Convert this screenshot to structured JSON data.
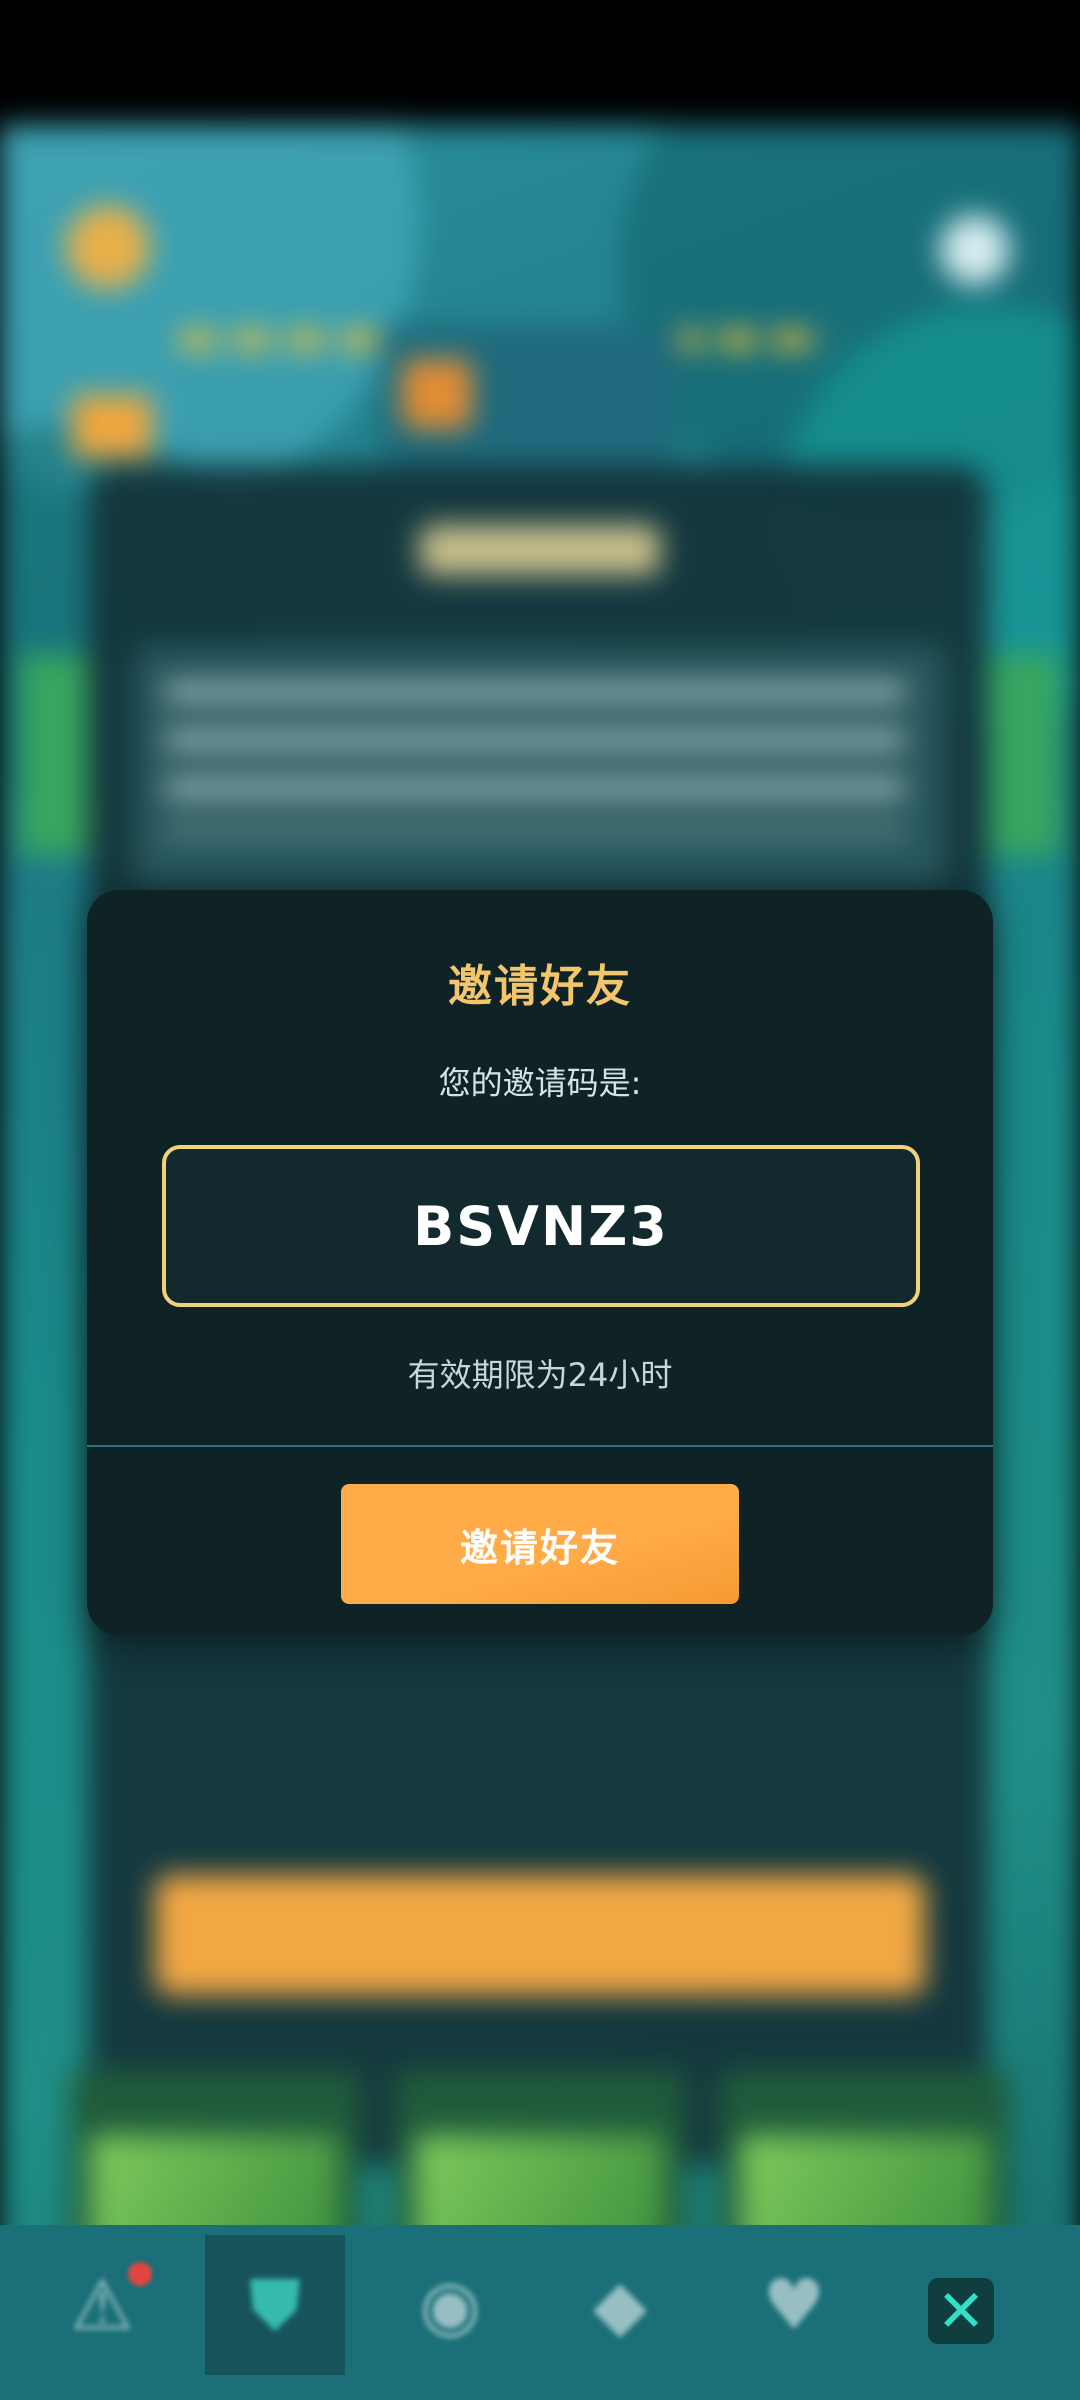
{
  "dialog": {
    "title": "邀请好友",
    "subtitle": "您的邀请码是:",
    "invite_code": "BSVNZ3",
    "expiry": "有效期限为24小时",
    "invite_button_label": "邀请好友"
  },
  "bottom_nav": {
    "items": [
      {
        "icon": "warning-triangle-icon",
        "glyph": "⚠"
      },
      {
        "icon": "shield-icon",
        "glyph": "⛊"
      },
      {
        "icon": "circle-icon",
        "glyph": "◉"
      },
      {
        "icon": "diamond-icon",
        "glyph": "◆"
      },
      {
        "icon": "heart-icon",
        "glyph": "♥"
      }
    ],
    "close_glyph": "✕"
  },
  "colors": {
    "accent_orange": "#ffab47",
    "title_gold": "#f3c66b",
    "code_border": "#f1d27a",
    "modal_bg": "#0f2226",
    "close_icon": "#32e0c8"
  }
}
